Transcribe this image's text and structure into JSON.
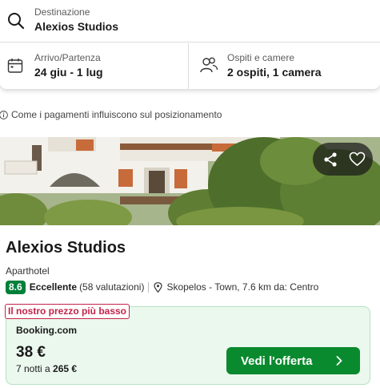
{
  "search": {
    "destination_label": "Destinazione",
    "destination_value": "Alexios Studios",
    "dates_label": "Arrivo/Partenza",
    "dates_value": "24 giu - 1 lug",
    "guests_label": "Ospiti e camere",
    "guests_value": "2 ospiti, 1 camera"
  },
  "info": {
    "text": "Come i pagamenti influiscono sul posizionamento"
  },
  "hotel": {
    "name": "Alexios Studios",
    "type": "Aparthotel",
    "rating_score": "8.6",
    "rating_word": "Eccellente",
    "rating_count": "(58 valutazioni)",
    "location": "Skopelos - Town, 7.6 km da: Centro"
  },
  "deal": {
    "badge": "Il nostro prezzo più basso",
    "provider": "Booking.com",
    "price": "38 €",
    "nights_prefix": "7 notti a",
    "total": "265 €",
    "cta_label": "Vedi l'offerta"
  },
  "colors": {
    "rating_green": "#007f3a",
    "cta_green": "#0a8a2e",
    "deal_bg": "#ebf8ee",
    "badge_red": "#c4224a"
  },
  "icons": [
    "search-icon",
    "calendar-icon",
    "guests-icon",
    "info-icon",
    "share-icon",
    "heart-icon",
    "map-pin-icon",
    "chevron-right-icon"
  ]
}
